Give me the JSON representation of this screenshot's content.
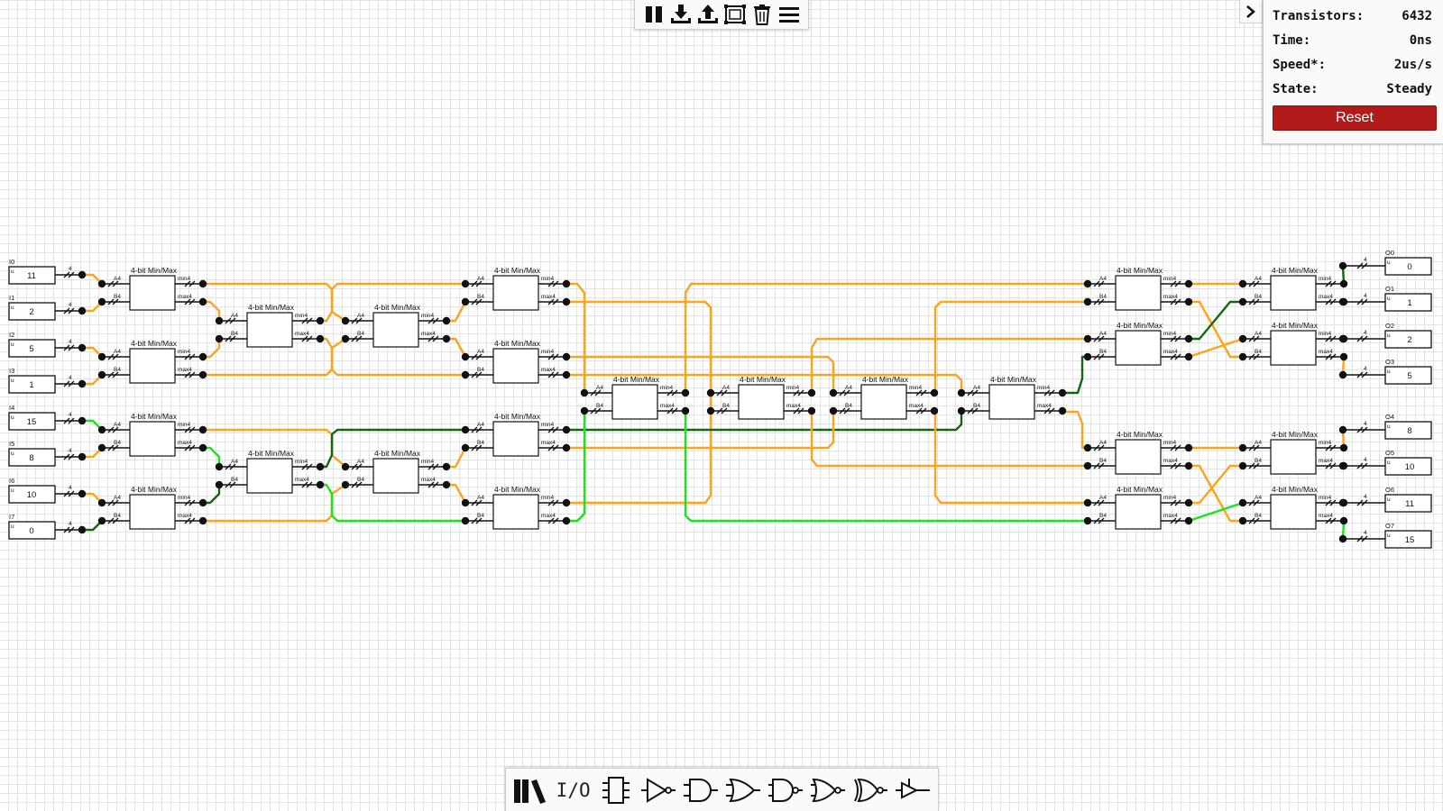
{
  "toolbar": {
    "buttons": [
      {
        "name": "pause-button",
        "icon": "pause-icon"
      },
      {
        "name": "download-button",
        "icon": "download-icon"
      },
      {
        "name": "upload-button",
        "icon": "upload-icon"
      },
      {
        "name": "fit-to-screen-button",
        "icon": "fit-screen-icon"
      },
      {
        "name": "delete-button",
        "icon": "trash-icon"
      },
      {
        "name": "menu-button",
        "icon": "hamburger-menu-icon"
      }
    ]
  },
  "info_panel": {
    "rows": [
      {
        "label": "Transistors:",
        "value": "6432"
      },
      {
        "label": "Time:",
        "value": "0ns"
      },
      {
        "label": "Speed*:",
        "value": "2us/s"
      },
      {
        "label": "State:",
        "value": "Steady"
      }
    ],
    "reset_label": "Reset",
    "reset_color": "#b31b1b"
  },
  "circuit": {
    "block_title": "4-bit Min/Max",
    "pin_labels": {
      "in_a": "A4",
      "in_b": "B4",
      "out_min": "min4",
      "out_max": "max4"
    },
    "bus_width": "4",
    "unsigned_tag": "u",
    "inputs": [
      {
        "name": "I0",
        "value": "11"
      },
      {
        "name": "I1",
        "value": "2"
      },
      {
        "name": "I2",
        "value": "5"
      },
      {
        "name": "I3",
        "value": "1"
      },
      {
        "name": "I4",
        "value": "15"
      },
      {
        "name": "I5",
        "value": "8"
      },
      {
        "name": "I6",
        "value": "10"
      },
      {
        "name": "I7",
        "value": "0"
      }
    ],
    "outputs": [
      {
        "name": "O0",
        "value": "0"
      },
      {
        "name": "O1",
        "value": "1"
      },
      {
        "name": "O2",
        "value": "2"
      },
      {
        "name": "O3",
        "value": "5"
      },
      {
        "name": "O4",
        "value": "8"
      },
      {
        "name": "O5",
        "value": "10"
      },
      {
        "name": "O6",
        "value": "11"
      },
      {
        "name": "O7",
        "value": "15"
      }
    ],
    "wire_colors": {
      "multi": "#ffa31a",
      "high": "#19e619",
      "low": "#136613"
    }
  },
  "palette": {
    "io_label": "I/O",
    "tools": [
      {
        "name": "library-tool",
        "icon": "library-icon"
      },
      {
        "name": "io-tool",
        "icon": "io-icon"
      },
      {
        "name": "chip-tool",
        "icon": "chip-icon"
      },
      {
        "name": "not-gate-tool",
        "icon": "not-gate-icon"
      },
      {
        "name": "and-gate-tool",
        "icon": "and-gate-icon"
      },
      {
        "name": "or-gate-tool",
        "icon": "or-gate-icon"
      },
      {
        "name": "nand-gate-tool",
        "icon": "nand-gate-icon"
      },
      {
        "name": "nor-gate-tool",
        "icon": "nor-gate-icon"
      },
      {
        "name": "xnor-gate-tool",
        "icon": "xnor-gate-icon"
      },
      {
        "name": "tristate-buffer-tool",
        "icon": "tristate-buffer-icon"
      }
    ]
  }
}
